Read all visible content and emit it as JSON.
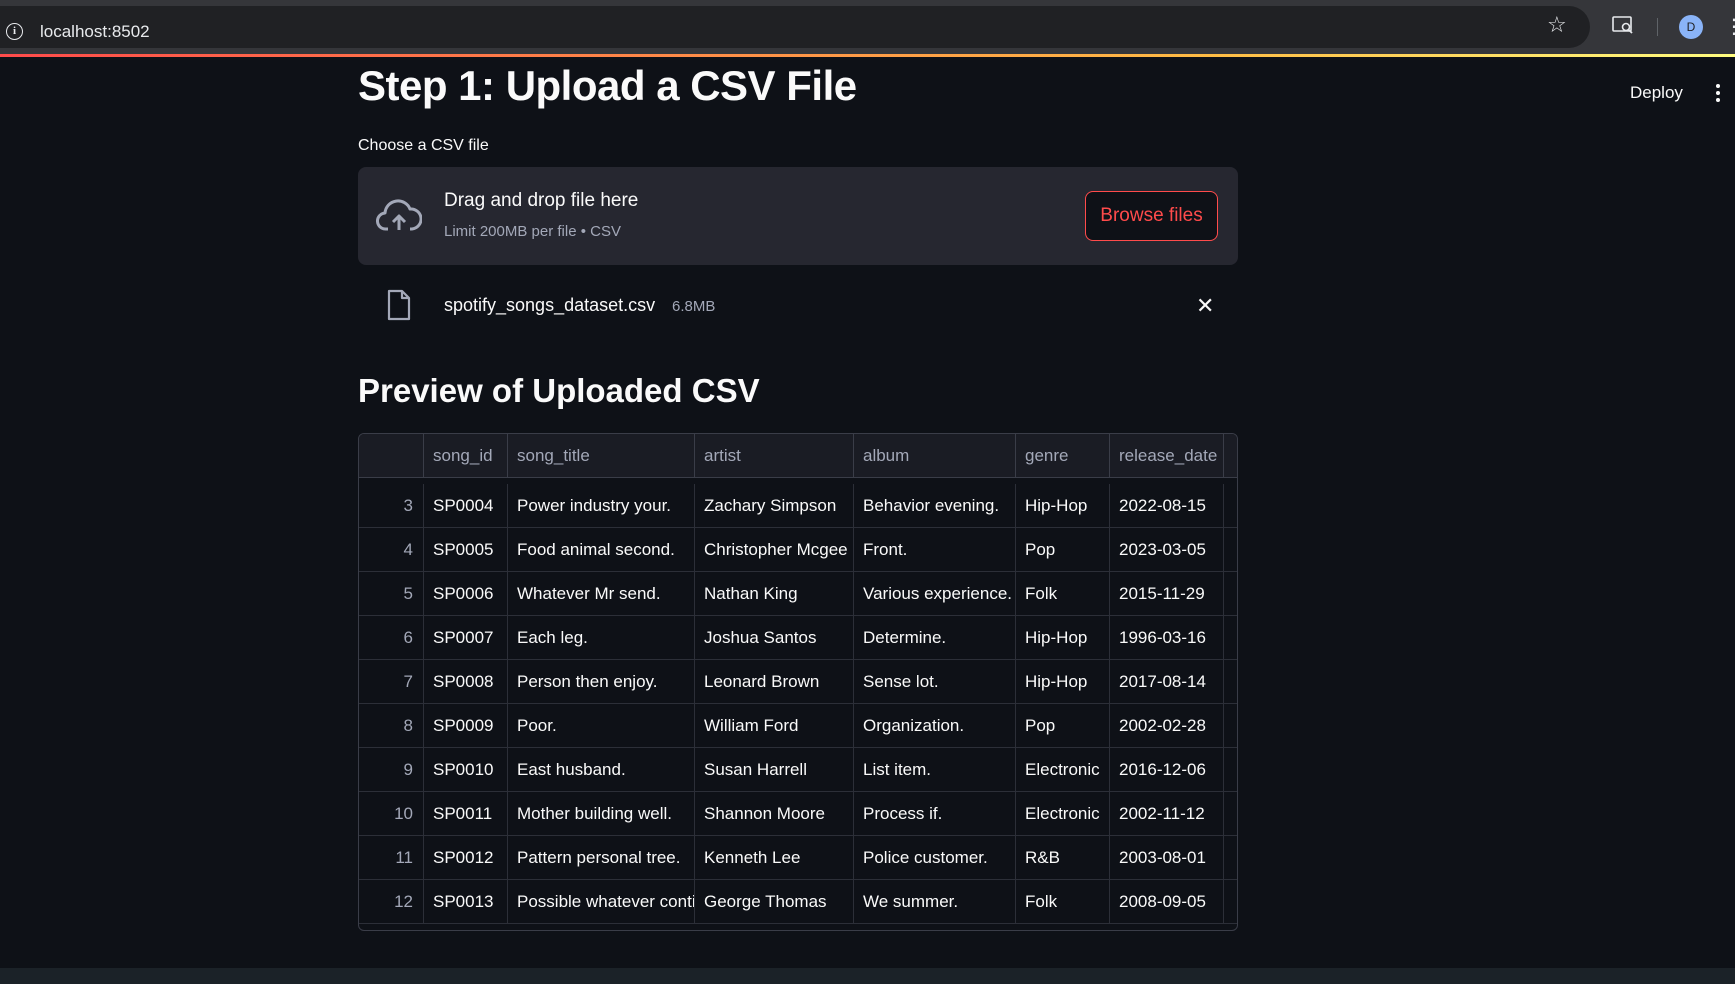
{
  "browser": {
    "url": "localhost:8502",
    "profile_initial": "D"
  },
  "header": {
    "deploy_label": "Deploy"
  },
  "page": {
    "title": "Step 1: Upload a CSV File",
    "uploader_label": "Choose a CSV file",
    "dropzone": {
      "title": "Drag and drop file here",
      "limit": "Limit 200MB per file • CSV",
      "browse_label": "Browse files"
    },
    "uploaded_file": {
      "name": "spotify_songs_dataset.csv",
      "size": "6.8MB"
    },
    "preview_title": "Preview of Uploaded CSV"
  },
  "table": {
    "columns": [
      "",
      "song_id",
      "song_title",
      "artist",
      "album",
      "genre",
      "release_date"
    ],
    "rows": [
      [
        "3",
        "SP0004",
        "Power industry your.",
        "Zachary Simpson",
        "Behavior evening.",
        "Hip-Hop",
        "2022-08-15"
      ],
      [
        "4",
        "SP0005",
        "Food animal second.",
        "Christopher Mcgee",
        "Front.",
        "Pop",
        "2023-03-05"
      ],
      [
        "5",
        "SP0006",
        "Whatever Mr send.",
        "Nathan King",
        "Various experience.",
        "Folk",
        "2015-11-29"
      ],
      [
        "6",
        "SP0007",
        "Each leg.",
        "Joshua Santos",
        "Determine.",
        "Hip-Hop",
        "1996-03-16"
      ],
      [
        "7",
        "SP0008",
        "Person then enjoy.",
        "Leonard Brown",
        "Sense lot.",
        "Hip-Hop",
        "2017-08-14"
      ],
      [
        "8",
        "SP0009",
        "Poor.",
        "William Ford",
        "Organization.",
        "Pop",
        "2002-02-28"
      ],
      [
        "9",
        "SP0010",
        "East husband.",
        "Susan Harrell",
        "List item.",
        "Electronic",
        "2016-12-06"
      ],
      [
        "10",
        "SP0011",
        "Mother building well.",
        "Shannon Moore",
        "Process if.",
        "Electronic",
        "2002-11-12"
      ],
      [
        "11",
        "SP0012",
        "Pattern personal tree.",
        "Kenneth Lee",
        "Police customer.",
        "R&B",
        "2003-08-01"
      ],
      [
        "12",
        "SP0013",
        "Possible whatever contir",
        "George Thomas",
        "We summer.",
        "Folk",
        "2008-09-05"
      ]
    ]
  },
  "icons": {
    "info": "info-icon",
    "star": "star-icon",
    "cloud_upload": "cloud-upload-icon",
    "file": "file-icon",
    "close": "close-icon"
  },
  "colors": {
    "background": "#0e1117",
    "dropzone": "#262730",
    "accent": "#ff4b4b"
  }
}
